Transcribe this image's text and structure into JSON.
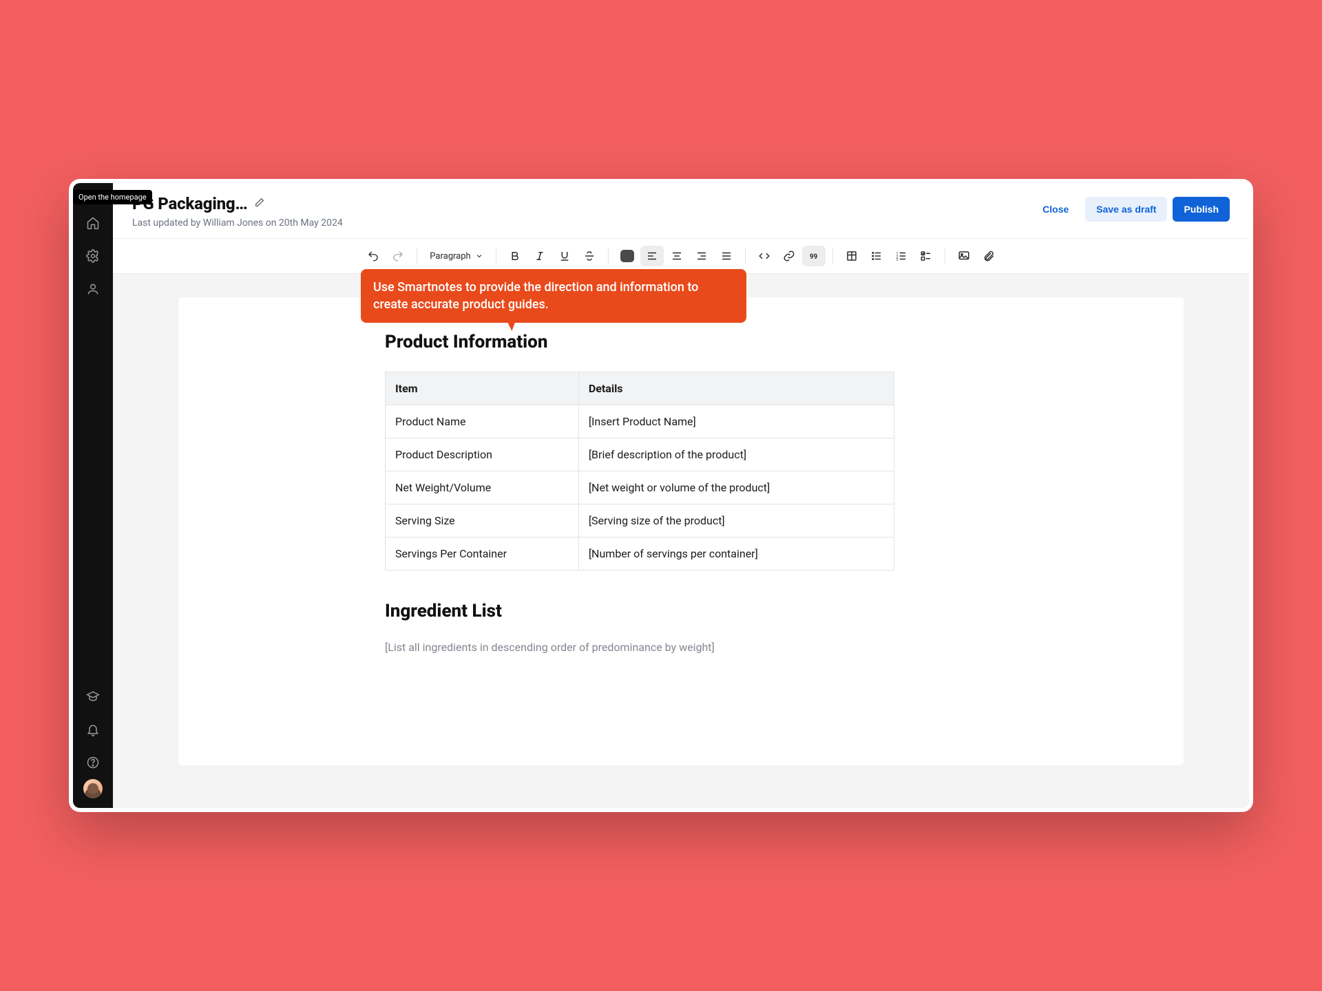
{
  "sidebar": {
    "tooltip": "Open the homepage"
  },
  "header": {
    "title": "PG Packaging…",
    "subtitle": "Last updated by William Jones on 20th May 2024",
    "actions": {
      "close": "Close",
      "save_draft": "Save as draft",
      "publish": "Publish"
    }
  },
  "toolbar": {
    "style_select": "Paragraph"
  },
  "callout": "Use Smartnotes to provide the direction and information to create accurate product guides.",
  "editor": {
    "heading1": "Product Information",
    "table": {
      "headers": {
        "item": "Item",
        "details": "Details"
      },
      "rows": [
        {
          "item": "Product Name",
          "details": "[Insert Product Name]"
        },
        {
          "item": "Product Description",
          "details": "[Brief description of the product]"
        },
        {
          "item": "Net Weight/Volume",
          "details": "[Net weight or volume of the product]"
        },
        {
          "item": "Serving Size",
          "details": "[Serving size of the product]"
        },
        {
          "item": "Servings Per Container",
          "details": "[Number of servings per container]"
        }
      ]
    },
    "heading2": "Ingredient List",
    "ingredient_placeholder": "[List all ingredients in descending order of predominance by weight]"
  }
}
